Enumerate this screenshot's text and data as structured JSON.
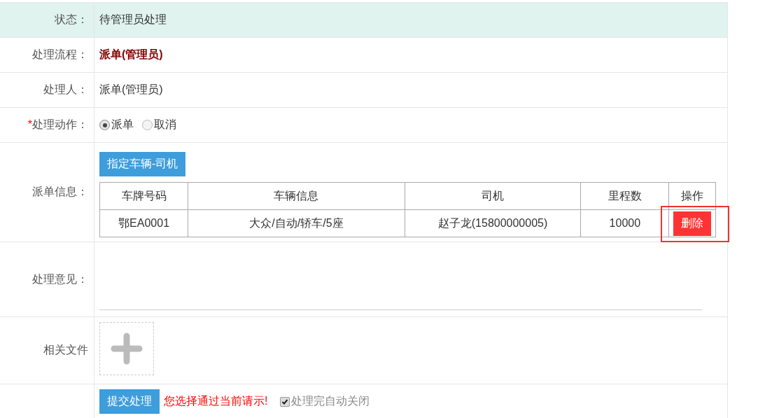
{
  "rows": [
    {
      "kind": "text",
      "label": "状态：",
      "value": "待管理员处理",
      "highlighted": true
    },
    {
      "kind": "emphasis",
      "label": "处理流程：",
      "value": "派单(管理员)",
      "highlighted": false
    },
    {
      "kind": "text",
      "label": "处理人：",
      "value": "派单(管理员)",
      "highlighted": false
    },
    {
      "kind": "radio",
      "label": "处理动作：",
      "required_mark": "*",
      "options": [
        {
          "label": "派单",
          "selected": true
        },
        {
          "label": "取消",
          "selected": false
        }
      ]
    },
    {
      "kind": "dispatch",
      "label": "派单信息：",
      "button": "指定车辆-司机",
      "table": {
        "columns": [
          "车牌号码",
          "车辆信息",
          "司机",
          "里程数",
          "操作"
        ],
        "rows": [
          {
            "cells": [
              "鄂EA0001",
              "大众/自动/轿车/5座",
              "赵子龙(15800000005)",
              "10000"
            ],
            "action": "删除",
            "annotated": true
          }
        ]
      }
    },
    {
      "kind": "textarea",
      "label": "处理意见："
    },
    {
      "kind": "upload",
      "label": "相关文件"
    },
    {
      "kind": "submit",
      "button": "提交处理",
      "message": "您选择通过当前请示!",
      "checkbox": {
        "label": "处理完自动关闭",
        "checked": true
      }
    }
  ]
}
